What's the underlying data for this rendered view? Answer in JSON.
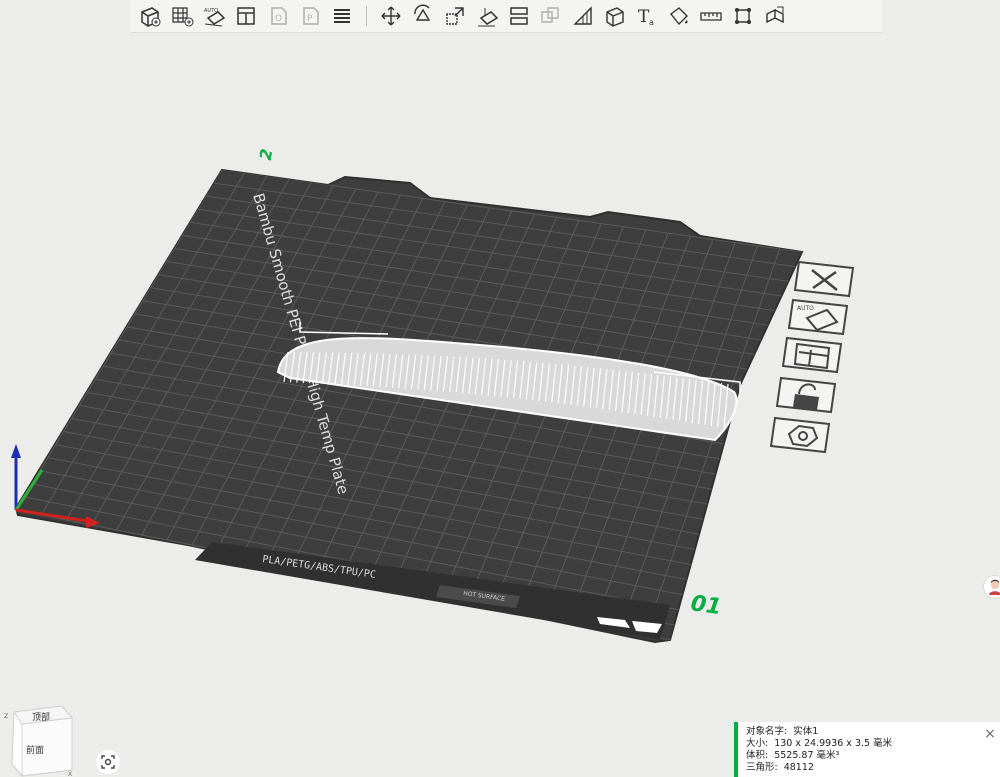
{
  "toolbar": {
    "items": [
      {
        "icon": "add-object-icon",
        "enabled": true
      },
      {
        "icon": "add-plate-icon",
        "enabled": true
      },
      {
        "icon": "auto-orient-icon",
        "enabled": true
      },
      {
        "icon": "arrange-icon",
        "enabled": true
      },
      {
        "icon": "split-objects-icon",
        "enabled": false
      },
      {
        "icon": "split-parts-icon",
        "enabled": false
      },
      {
        "icon": "layers-icon",
        "enabled": true
      },
      {
        "icon": "move-icon",
        "enabled": true
      },
      {
        "icon": "rotate-icon",
        "enabled": true
      },
      {
        "icon": "scale-icon",
        "enabled": true
      },
      {
        "icon": "lay-on-face-icon",
        "enabled": true
      },
      {
        "icon": "cut-icon",
        "enabled": true
      },
      {
        "icon": "boolean-icon",
        "enabled": false
      },
      {
        "icon": "support-paint-icon",
        "enabled": true
      },
      {
        "icon": "seam-paint-icon",
        "enabled": true
      },
      {
        "icon": "text-icon",
        "enabled": true
      },
      {
        "icon": "color-paint-icon",
        "enabled": true
      },
      {
        "icon": "measure-icon",
        "enabled": true
      },
      {
        "icon": "assembly-icon",
        "enabled": true
      },
      {
        "icon": "explode-icon",
        "enabled": true
      }
    ]
  },
  "plate": {
    "brand_text": "Bambu Smooth PEI Plate/High Temp Plate",
    "material_text": "PLA/PETG/ABS/TPU/PC",
    "hot_surface_text": "HOT SURFACE",
    "plate_number": "01",
    "plate_index_mark": "2"
  },
  "object_menu": {
    "items": [
      "delete-icon",
      "auto-orient-icon",
      "arrange-icon",
      "lock-icon",
      "settings-icon"
    ]
  },
  "view_cube": {
    "top_label": "顶部",
    "front_label": "前面",
    "axis_z": "Z",
    "axis_x": "X"
  },
  "info": {
    "name_label": "对象名字:",
    "name_value": "实体1",
    "size_label": "大小:",
    "size_value": "130 x 24.9936 x 3.5 毫米",
    "volume_label": "体积:",
    "volume_value": "5525.87 毫米³",
    "triangles_label": "三角形:",
    "triangles_value": "48112"
  },
  "colors": {
    "accent": "#00ae42",
    "plate": "#3d3e3d",
    "background": "#ececea"
  }
}
